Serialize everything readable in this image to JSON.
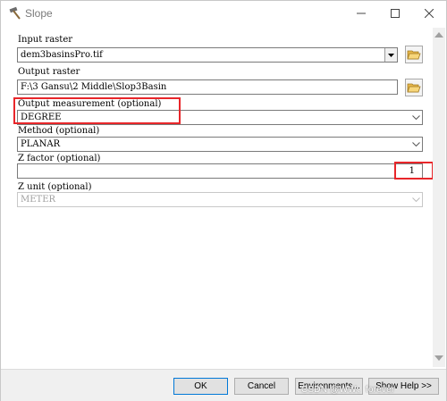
{
  "window": {
    "title": "Slope",
    "icon": "hammer-icon"
  },
  "form": {
    "input_raster": {
      "label": "Input raster",
      "value": "dem3basinsPro.tif"
    },
    "output_raster": {
      "label": "Output raster",
      "value": "F:\\3 Gansu\\2 Middle\\Slop3Basin"
    },
    "output_measurement": {
      "label": "Output measurement (optional)",
      "value": "DEGREE"
    },
    "method": {
      "label": "Method (optional)",
      "value": "PLANAR"
    },
    "z_factor": {
      "label": "Z factor (optional)",
      "value": "1"
    },
    "z_unit": {
      "label": "Z unit (optional)",
      "value": "METER"
    }
  },
  "buttons": {
    "ok": "OK",
    "cancel": "Cancel",
    "environments": "Environments...",
    "show_help": "Show Help >>"
  },
  "watermark": "CSDN @WW、forever",
  "colors": {
    "highlight": "#e8262a",
    "default_button_border": "#0078d7"
  }
}
